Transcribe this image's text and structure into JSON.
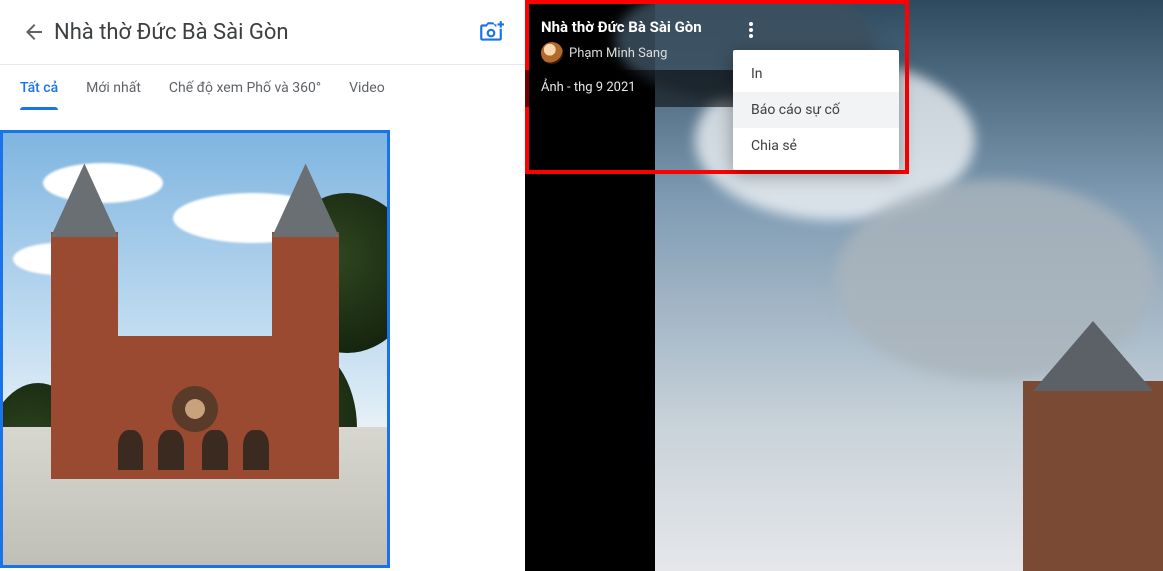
{
  "header": {
    "title": "Nhà thờ Đức Bà Sài Gòn"
  },
  "tabs": [
    {
      "label": "Tất cả",
      "active": true
    },
    {
      "label": "Mới nhất",
      "active": false
    },
    {
      "label": "Chế độ xem Phố và 360°",
      "active": false
    },
    {
      "label": "Video",
      "active": false
    }
  ],
  "viewer": {
    "title": "Nhà thờ Đức Bà Sài Gòn",
    "author": "Phạm Minh Sang",
    "meta": "Ảnh - thg 9 2021",
    "menu": [
      {
        "label": "In",
        "hover": false
      },
      {
        "label": "Báo cáo sự cố",
        "hover": true
      },
      {
        "label": "Chia sẻ",
        "hover": false
      }
    ]
  }
}
